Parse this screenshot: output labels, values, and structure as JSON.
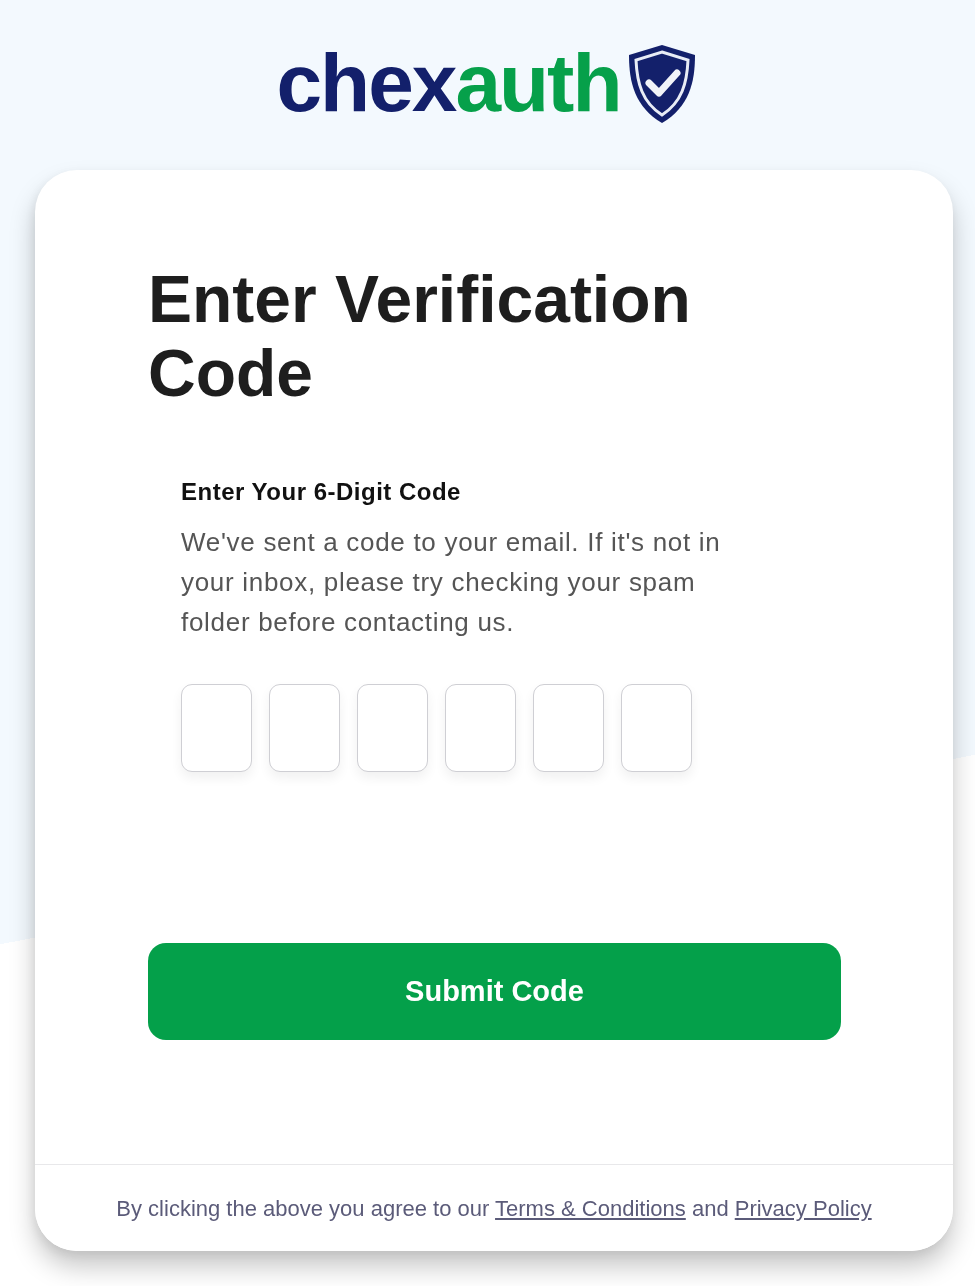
{
  "logo": {
    "first_part": "chex",
    "second_part": "auth"
  },
  "title": "Enter Verification Code",
  "code_form": {
    "label": "Enter Your 6-Digit Code",
    "description": "We've sent a code to your email. If it's not in your inbox, please try checking your spam folder before contacting us.",
    "digit_fields": [
      {
        "focused": false
      },
      {
        "focused": false
      },
      {
        "focused": false
      },
      {
        "focused": false
      },
      {
        "focused": false
      },
      {
        "focused": false
      }
    ]
  },
  "submit_button": {
    "label": "Submit Code"
  },
  "footer": {
    "text_before": "By clicking the above you agree to our",
    "terms_link": "Terms & Conditions",
    "joiner": "and",
    "privacy_link": "Privacy Policy"
  }
}
